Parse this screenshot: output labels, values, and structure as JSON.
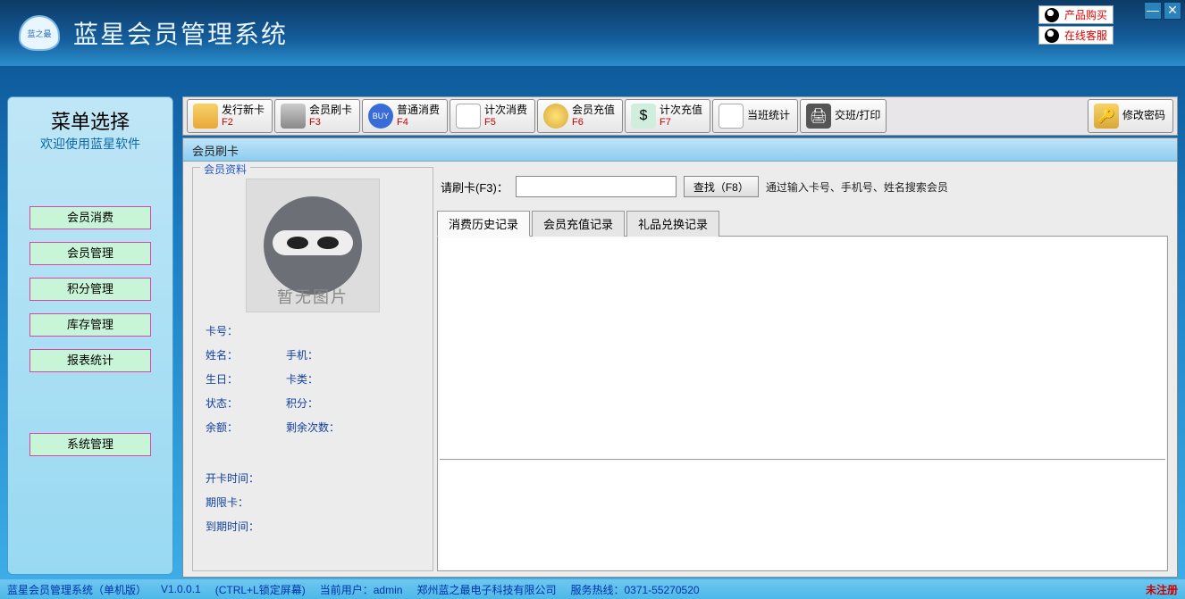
{
  "app": {
    "title": "蓝星会员管理系统",
    "logo_text": "蓝之最"
  },
  "top_links": {
    "buy": "产品购买",
    "service": "在线客服"
  },
  "sidebar": {
    "title": "菜单选择",
    "subtitle": "欢迎使用蓝星软件",
    "items": [
      "会员消费",
      "会员管理",
      "积分管理",
      "库存管理",
      "报表统计"
    ],
    "bottom": "系统管理"
  },
  "toolbar": [
    {
      "label": "发行新卡",
      "fn": "F2",
      "icon": "card"
    },
    {
      "label": "会员刷卡",
      "fn": "F3",
      "icon": "swipe"
    },
    {
      "label": "普通消费",
      "fn": "F4",
      "icon": "buy"
    },
    {
      "label": "计次消费",
      "fn": "F5",
      "icon": "note"
    },
    {
      "label": "会员充值",
      "fn": "F6",
      "icon": "coin"
    },
    {
      "label": "计次充值",
      "fn": "F7",
      "icon": "money"
    },
    {
      "label": "当班统计",
      "fn": "",
      "icon": "doc"
    },
    {
      "label": "交班/打印",
      "fn": "",
      "icon": "print"
    }
  ],
  "toolbar_right": {
    "label": "修改密码",
    "icon": "key"
  },
  "main": {
    "header": "会员刷卡",
    "member_legend": "会员资料",
    "avatar_placeholder": "暂无图片",
    "fields": {
      "card_no": "卡号：",
      "name": "姓名：",
      "phone": "手机：",
      "birthday": "生日：",
      "card_type": "卡类：",
      "status": "状态：",
      "points": "积分：",
      "balance": "余额：",
      "remain_times": "剩余次数：",
      "open_time": "开卡时间：",
      "limit_card": "期限卡：",
      "expire_time": "到期时间："
    },
    "search": {
      "label": "请刷卡(F3)：",
      "btn": "查找（F8）",
      "hint": "通过输入卡号、手机号、姓名搜索会员"
    },
    "tabs": [
      "消费历史记录",
      "会员充值记录",
      "礼品兑换记录"
    ]
  },
  "status": {
    "product": "蓝星会员管理系统（单机版）",
    "version": "V1.0.0.1",
    "lock_hint": "(CTRL+L锁定屏幕)",
    "user_label": "当前用户：",
    "user": "admin",
    "company": "郑州蓝之最电子科技有限公司",
    "hotline_label": "服务热线：",
    "hotline": "0371-55270520",
    "unregistered": "未注册"
  }
}
